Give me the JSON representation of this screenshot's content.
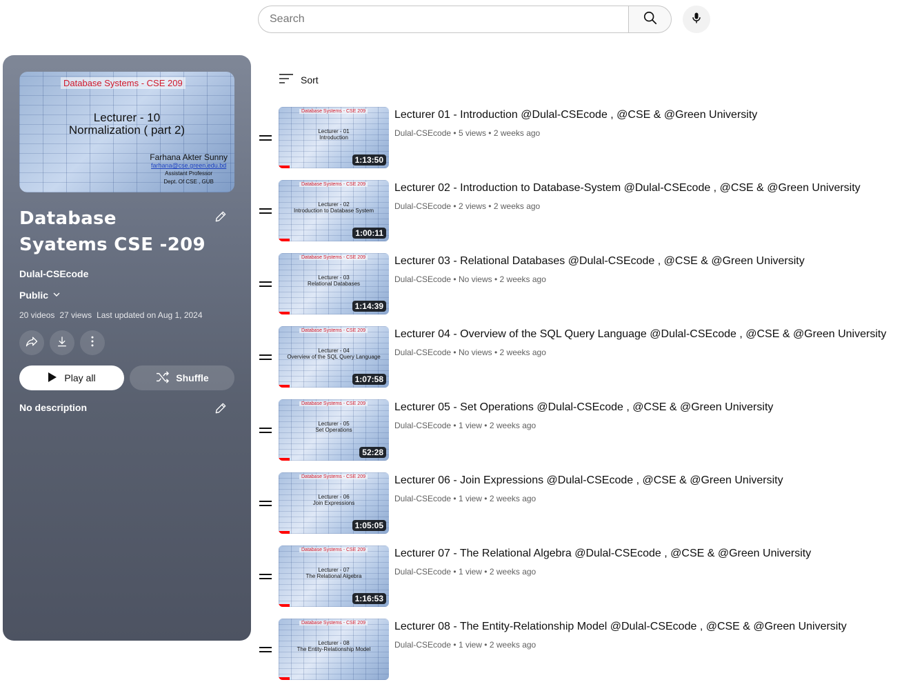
{
  "search": {
    "placeholder": "Search"
  },
  "playlist": {
    "thumb": {
      "header": "Database Systems - CSE 209",
      "lecture": "Lecturer - 10",
      "topic": "Normalization ( part 2)",
      "author": "Farhana Akter Sunny",
      "email": "farhana@cse.green.edu.bd",
      "role": "Assistant Professor",
      "dept": "Dept. Of CSE , GUB"
    },
    "title": "Database Syatems CSE -209",
    "owner": "Dulal-CSEcode",
    "privacy": "Public",
    "videos": "20 videos",
    "views": "27 views",
    "updated": "Last updated on Aug 1, 2024",
    "play_all": "Play all",
    "shuffle": "Shuffle",
    "description": "No description"
  },
  "sort_label": "Sort",
  "thumb_header": "Database Systems - CSE 209",
  "videos": [
    {
      "title": "Lecturer 01 - Introduction @Dulal-CSEcode , @CSE & @Green University",
      "channel": "Dulal-CSEcode",
      "views": "5 views",
      "age": "2 weeks ago",
      "duration": "1:13:50",
      "thumb_lecture": "Lecturer - 01",
      "thumb_topic": "Introduction"
    },
    {
      "title": "Lecturer 02 - Introduction to Database-System @Dulal-CSEcode , @CSE & @Green University",
      "channel": "Dulal-CSEcode",
      "views": "2 views",
      "age": "2 weeks ago",
      "duration": "1:00:11",
      "thumb_lecture": "Lecturer - 02",
      "thumb_topic": "Introduction to Database System"
    },
    {
      "title": "Lecturer 03 - Relational Databases @Dulal-CSEcode , @CSE & @Green University",
      "channel": "Dulal-CSEcode",
      "views": "No views",
      "age": "2 weeks ago",
      "duration": "1:14:39",
      "thumb_lecture": "Lecturer - 03",
      "thumb_topic": "Relational Databases"
    },
    {
      "title": "Lecturer 04 - Overview of the SQL Query Language @Dulal-CSEcode , @CSE & @Green University",
      "channel": "Dulal-CSEcode",
      "views": "No views",
      "age": "2 weeks ago",
      "duration": "1:07:58",
      "thumb_lecture": "Lecturer - 04",
      "thumb_topic": "Overview of the SQL Query Language"
    },
    {
      "title": "Lecturer 05 - Set Operations @Dulal-CSEcode , @CSE & @Green University",
      "channel": "Dulal-CSEcode",
      "views": "1 view",
      "age": "2 weeks ago",
      "duration": "52:28",
      "thumb_lecture": "Lecturer - 05",
      "thumb_topic": "Set Operations"
    },
    {
      "title": "Lecturer 06 - Join Expressions @Dulal-CSEcode , @CSE & @Green University",
      "channel": "Dulal-CSEcode",
      "views": "1 view",
      "age": "2 weeks ago",
      "duration": "1:05:05",
      "thumb_lecture": "Lecturer - 06",
      "thumb_topic": "Join Expressions"
    },
    {
      "title": "Lecturer 07 - The Relational Algebra @Dulal-CSEcode , @CSE & @Green University",
      "channel": "Dulal-CSEcode",
      "views": "1 view",
      "age": "2 weeks ago",
      "duration": "1:16:53",
      "thumb_lecture": "Lecturer - 07",
      "thumb_topic": "The Relational Algebra"
    },
    {
      "title": "Lecturer 08 - The Entity-Relationship Model @Dulal-CSEcode , @CSE & @Green University",
      "channel": "Dulal-CSEcode",
      "views": "1 view",
      "age": "2 weeks ago",
      "duration": "",
      "thumb_lecture": "Lecturer - 08",
      "thumb_topic": "The Entity-Relationship Model"
    }
  ]
}
